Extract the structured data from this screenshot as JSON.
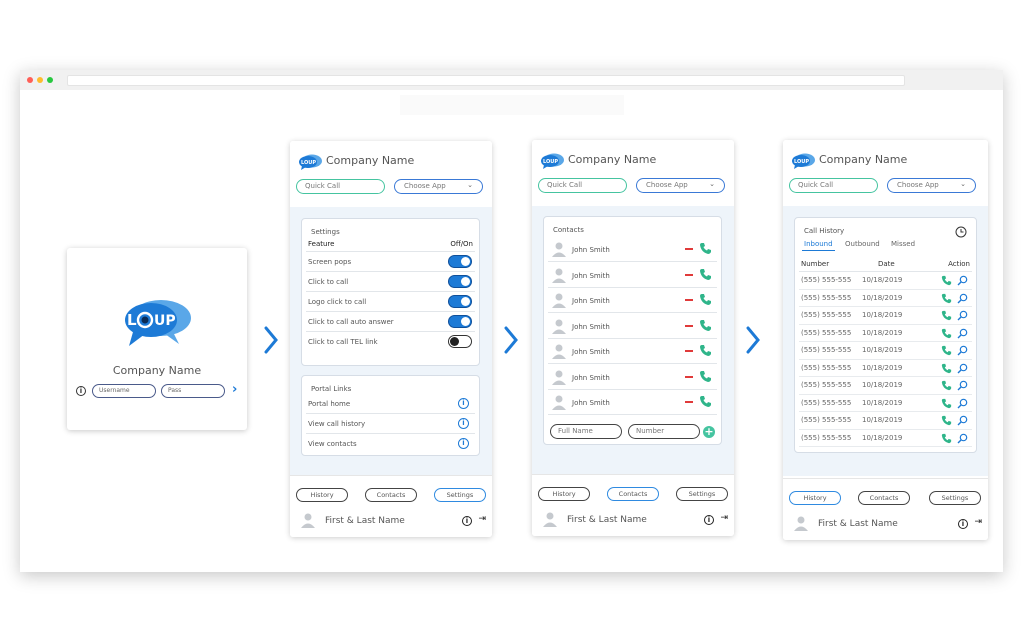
{
  "company_name": "Company Name",
  "logo_text": "LOUP",
  "login": {
    "username_placeholder": "Username",
    "pass_placeholder": "Pass"
  },
  "header": {
    "quick_call": "Quick Call",
    "choose_app": "Choose App"
  },
  "settings": {
    "title": "Settings",
    "col_feature": "Feature",
    "col_onoff": "Off/On",
    "items": [
      {
        "label": "Screen pops",
        "on": true
      },
      {
        "label": "Click to call",
        "on": true
      },
      {
        "label": "Logo click to call",
        "on": true
      },
      {
        "label": "Click to call auto answer",
        "on": true
      },
      {
        "label": "Click to call TEL link",
        "on": false
      }
    ]
  },
  "portal": {
    "title": "Portal Links",
    "items": [
      "Portal home",
      "View call history",
      "View contacts"
    ]
  },
  "contacts": {
    "title": "Contacts",
    "items": [
      "John Smith",
      "John Smith",
      "John Smith",
      "John Smith",
      "John Smith",
      "John Smith",
      "John Smith"
    ],
    "full_name_placeholder": "Full Name",
    "number_placeholder": "Number"
  },
  "history": {
    "title": "Call History",
    "tabs": [
      "Inbound",
      "Outbound",
      "Missed"
    ],
    "columns": [
      "Number",
      "Date",
      "Action"
    ],
    "rows": [
      {
        "number": "(555) 555-555",
        "date": "10/18/2019"
      },
      {
        "number": "(555) 555-555",
        "date": "10/18/2019"
      },
      {
        "number": "(555) 555-555",
        "date": "10/18/2019"
      },
      {
        "number": "(555) 555-555",
        "date": "10/18/2019"
      },
      {
        "number": "(555) 555-555",
        "date": "10/18/2019"
      },
      {
        "number": "(555) 555-555",
        "date": "10/18/2019"
      },
      {
        "number": "(555) 555-555",
        "date": "10/18/2019"
      },
      {
        "number": "(555) 555-555",
        "date": "10/18/2019"
      },
      {
        "number": "(555) 555-555",
        "date": "10/18/2019"
      },
      {
        "number": "(555) 555-555",
        "date": "10/18/2019"
      }
    ]
  },
  "footer": {
    "tabs": [
      "History",
      "Contacts",
      "Settings"
    ],
    "user_name": "First & Last Name"
  },
  "colors": {
    "accent_blue": "#1d7ad6",
    "accent_green": "#45c4a0",
    "delete_red": "#e03a3a"
  }
}
